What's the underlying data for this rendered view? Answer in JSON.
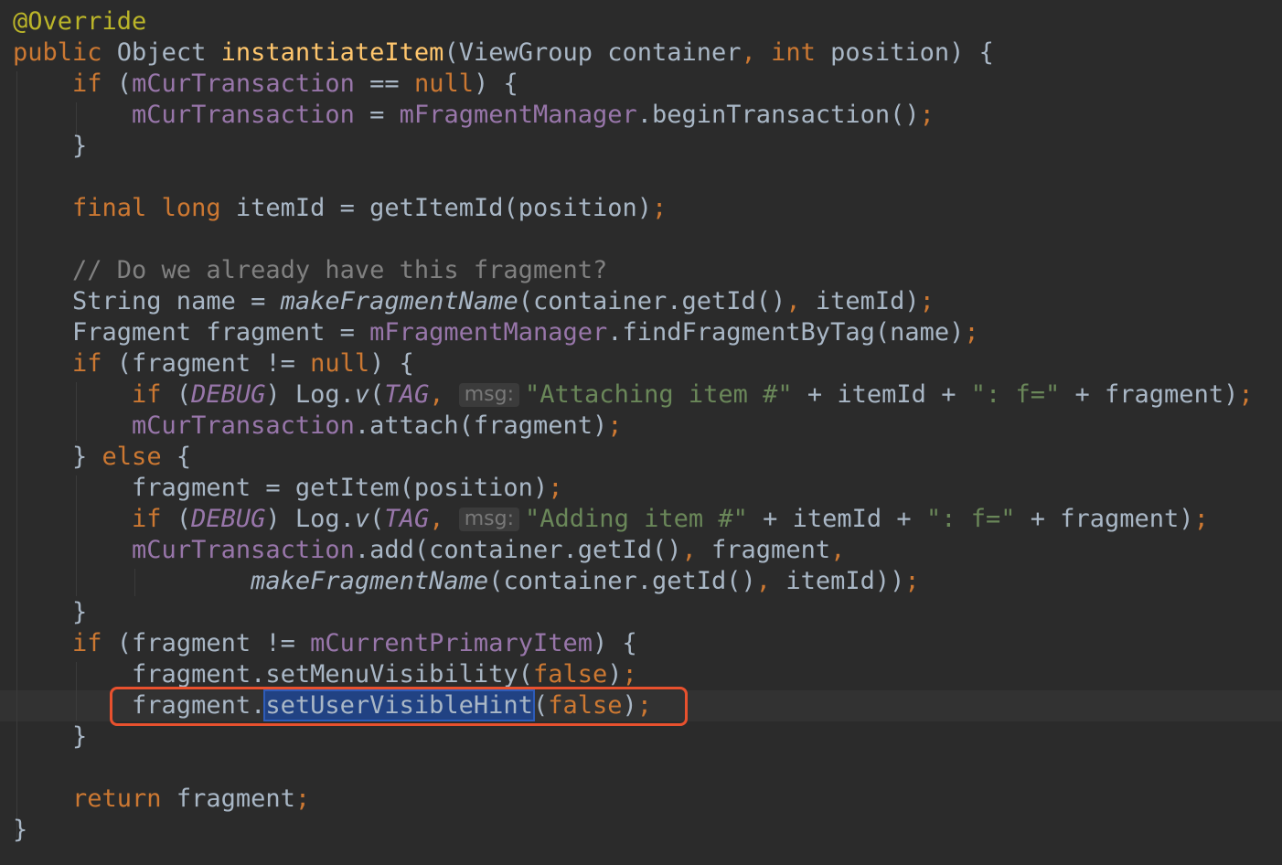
{
  "editor": {
    "lines": [
      [
        {
          "t": "@Override",
          "c": "annot"
        }
      ],
      [
        {
          "t": "public",
          "c": "kw"
        },
        {
          "t": " Object "
        },
        {
          "t": "instantiateItem",
          "c": "fn"
        },
        {
          "t": "(ViewGroup container"
        },
        {
          "t": ",",
          "c": "kw"
        },
        {
          "t": " "
        },
        {
          "t": "int",
          "c": "kw"
        },
        {
          "t": " position) {"
        }
      ],
      [
        {
          "t": "    "
        },
        {
          "t": "if",
          "c": "kw"
        },
        {
          "t": " ("
        },
        {
          "t": "mCurTransaction",
          "c": "field"
        },
        {
          "t": " == "
        },
        {
          "t": "null",
          "c": "kw"
        },
        {
          "t": ") {"
        }
      ],
      [
        {
          "t": "        "
        },
        {
          "t": "mCurTransaction",
          "c": "field"
        },
        {
          "t": " = "
        },
        {
          "t": "mFragmentManager",
          "c": "field"
        },
        {
          "t": ".beginTransaction()"
        },
        {
          "t": ";",
          "c": "kw"
        }
      ],
      [
        {
          "t": "    }"
        }
      ],
      [],
      [
        {
          "t": "    "
        },
        {
          "t": "final",
          "c": "kw"
        },
        {
          "t": " "
        },
        {
          "t": "long",
          "c": "kw"
        },
        {
          "t": " itemId = getItemId(position)"
        },
        {
          "t": ";",
          "c": "kw"
        }
      ],
      [],
      [
        {
          "t": "    // Do we already have this fragment?",
          "c": "comment"
        }
      ],
      [
        {
          "t": "    String name = "
        },
        {
          "t": "makeFragmentName",
          "c": "italic"
        },
        {
          "t": "(container.getId()"
        },
        {
          "t": ",",
          "c": "kw"
        },
        {
          "t": " itemId)"
        },
        {
          "t": ";",
          "c": "kw"
        }
      ],
      [
        {
          "t": "    Fragment fragment = "
        },
        {
          "t": "mFragmentManager",
          "c": "field"
        },
        {
          "t": ".findFragmentByTag(name)"
        },
        {
          "t": ";",
          "c": "kw"
        }
      ],
      [
        {
          "t": "    "
        },
        {
          "t": "if",
          "c": "kw"
        },
        {
          "t": " (fragment != "
        },
        {
          "t": "null",
          "c": "kw"
        },
        {
          "t": ") {"
        }
      ],
      [
        {
          "t": "        "
        },
        {
          "t": "if",
          "c": "kw"
        },
        {
          "t": " ("
        },
        {
          "t": "DEBUG",
          "c": "static"
        },
        {
          "t": ") Log."
        },
        {
          "t": "v",
          "c": "italic"
        },
        {
          "t": "("
        },
        {
          "t": "TAG",
          "c": "static"
        },
        {
          "t": ",",
          "c": "kw"
        },
        {
          "t": " "
        },
        {
          "t": "msg:",
          "c": "hint"
        },
        {
          "t": "\"Attaching item #\"",
          "c": "str"
        },
        {
          "t": " + itemId + "
        },
        {
          "t": "\": f=\"",
          "c": "str"
        },
        {
          "t": " + fragment)"
        },
        {
          "t": ";",
          "c": "kw"
        }
      ],
      [
        {
          "t": "        "
        },
        {
          "t": "mCurTransaction",
          "c": "field"
        },
        {
          "t": ".attach(fragment)"
        },
        {
          "t": ";",
          "c": "kw"
        }
      ],
      [
        {
          "t": "    } "
        },
        {
          "t": "else",
          "c": "kw"
        },
        {
          "t": " {"
        }
      ],
      [
        {
          "t": "        fragment = getItem(position)"
        },
        {
          "t": ";",
          "c": "kw"
        }
      ],
      [
        {
          "t": "        "
        },
        {
          "t": "if",
          "c": "kw"
        },
        {
          "t": " ("
        },
        {
          "t": "DEBUG",
          "c": "static"
        },
        {
          "t": ") Log."
        },
        {
          "t": "v",
          "c": "italic"
        },
        {
          "t": "("
        },
        {
          "t": "TAG",
          "c": "static"
        },
        {
          "t": ",",
          "c": "kw"
        },
        {
          "t": " "
        },
        {
          "t": "msg:",
          "c": "hint"
        },
        {
          "t": "\"Adding item #\"",
          "c": "str"
        },
        {
          "t": " + itemId + "
        },
        {
          "t": "\": f=\"",
          "c": "str"
        },
        {
          "t": " + fragment)"
        },
        {
          "t": ";",
          "c": "kw"
        }
      ],
      [
        {
          "t": "        "
        },
        {
          "t": "mCurTransaction",
          "c": "field"
        },
        {
          "t": ".add(container.getId()"
        },
        {
          "t": ",",
          "c": "kw"
        },
        {
          "t": " fragment"
        },
        {
          "t": ",",
          "c": "kw"
        }
      ],
      [
        {
          "t": "                "
        },
        {
          "t": "makeFragmentName",
          "c": "italic"
        },
        {
          "t": "(container.getId()"
        },
        {
          "t": ",",
          "c": "kw"
        },
        {
          "t": " itemId))"
        },
        {
          "t": ";",
          "c": "kw"
        }
      ],
      [
        {
          "t": "    }"
        }
      ],
      [
        {
          "t": "    "
        },
        {
          "t": "if",
          "c": "kw"
        },
        {
          "t": " (fragment != "
        },
        {
          "t": "mCurrentPrimaryItem",
          "c": "field"
        },
        {
          "t": ") {"
        }
      ],
      [
        {
          "t": "        fragment.setMenuVisibility("
        },
        {
          "t": "false",
          "c": "kw"
        },
        {
          "t": ")"
        },
        {
          "t": ";",
          "c": "kw"
        }
      ],
      [
        {
          "t": "        fragment."
        },
        {
          "t": "setUserVisibleHint",
          "c": "sel"
        },
        {
          "t": "("
        },
        {
          "t": "false",
          "c": "kw"
        },
        {
          "t": ")"
        },
        {
          "t": ";",
          "c": "kw"
        }
      ],
      [
        {
          "t": "    }"
        }
      ],
      [],
      [
        {
          "t": "    "
        },
        {
          "t": "return",
          "c": "kw"
        },
        {
          "t": " fragment"
        },
        {
          "t": ";",
          "c": "kw"
        }
      ],
      [
        {
          "t": "}"
        }
      ]
    ]
  }
}
